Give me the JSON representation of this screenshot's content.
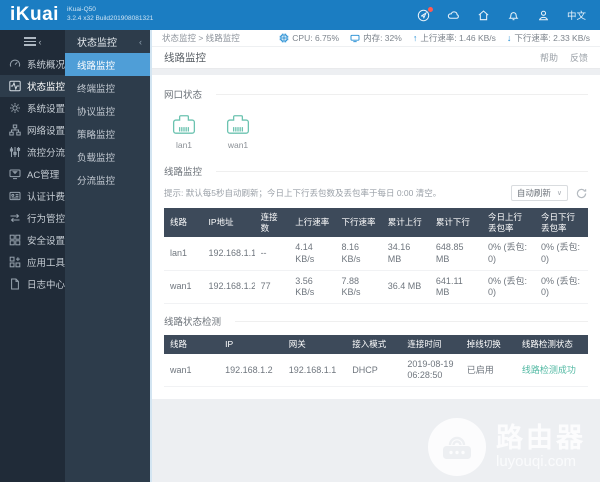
{
  "topbar": {
    "logo": "iKuai",
    "model": "iKuai-Q50",
    "build": "3.2.4 x32 Build201908081321",
    "language": "中文"
  },
  "sidebar": {
    "items": [
      {
        "label": "系统概况"
      },
      {
        "label": "状态监控"
      },
      {
        "label": "系统设置"
      },
      {
        "label": "网络设置"
      },
      {
        "label": "流控分流"
      },
      {
        "label": "AC管理"
      },
      {
        "label": "认证计费"
      },
      {
        "label": "行为管控"
      },
      {
        "label": "安全设置"
      },
      {
        "label": "应用工具"
      },
      {
        "label": "日志中心"
      }
    ]
  },
  "submenu": {
    "title": "状态监控",
    "collapse": "‹",
    "items": [
      {
        "label": "线路监控"
      },
      {
        "label": "终端监控"
      },
      {
        "label": "协议监控"
      },
      {
        "label": "策略监控"
      },
      {
        "label": "负载监控"
      },
      {
        "label": "分流监控"
      }
    ]
  },
  "statusbar": {
    "breadcrumb": "状态监控 > 线路监控",
    "cpu": "CPU: 6.75%",
    "memory": "内存: 32%",
    "up_arrow": "↑",
    "upload": "上行速率: 1.46 KB/s",
    "down_arrow": "↓",
    "download": "下行速率: 2.33 KB/s"
  },
  "page": {
    "title": "线路监控",
    "help": "帮助",
    "feedback": "反馈"
  },
  "port_status": {
    "section_title": "网口状态",
    "ports": [
      {
        "name": "lan1"
      },
      {
        "name": "wan1"
      }
    ]
  },
  "line_monitor": {
    "section_title": "线路监控",
    "hint": "提示: 默认每5秒自动刷新；今日上下行丢包数及丢包率于每日 0:00 清空。",
    "refresh_mode": "自动刷新",
    "refresh_chevron": "∨",
    "headers": [
      "线路",
      "IP地址",
      "连接数",
      "上行速率",
      "下行速率",
      "累计上行",
      "累计下行",
      "今日上行丢包率",
      "今日下行丢包率"
    ],
    "rows": [
      [
        "lan1",
        "192.168.1.1",
        "--",
        "4.14 KB/s",
        "8.16 KB/s",
        "34.16 MB",
        "648.85 MB",
        "0% (丢包: 0)",
        "0% (丢包: 0)"
      ],
      [
        "wan1",
        "192.168.1.2",
        "77",
        "3.56 KB/s",
        "7.88 KB/s",
        "36.4 MB",
        "641.11 MB",
        "0% (丢包: 0)",
        "0% (丢包: 0)"
      ]
    ]
  },
  "line_check": {
    "section_title": "线路状态检测",
    "headers": [
      "线路",
      "IP",
      "网关",
      "接入模式",
      "连接时间",
      "掉线切换",
      "线路检测状态"
    ],
    "rows": [
      [
        "wan1",
        "192.168.1.2",
        "192.168.1.1",
        "DHCP",
        "2019-08-19 06:28:50",
        "已启用",
        "线路检测成功"
      ]
    ]
  },
  "watermark": {
    "name": "路由器",
    "site": "luyouqi.com"
  },
  "colors": {
    "topbar_blue": "#1b7dc2",
    "sidebar_dark": "#202b38",
    "panel_slate": "#2d3c4b",
    "active_blue": "#4f9ed7",
    "table_header": "#3d4a5a",
    "accent_teal": "#62bfae",
    "status_icon_blue": "#1d8ad2",
    "success_text": "#52b9a3"
  }
}
